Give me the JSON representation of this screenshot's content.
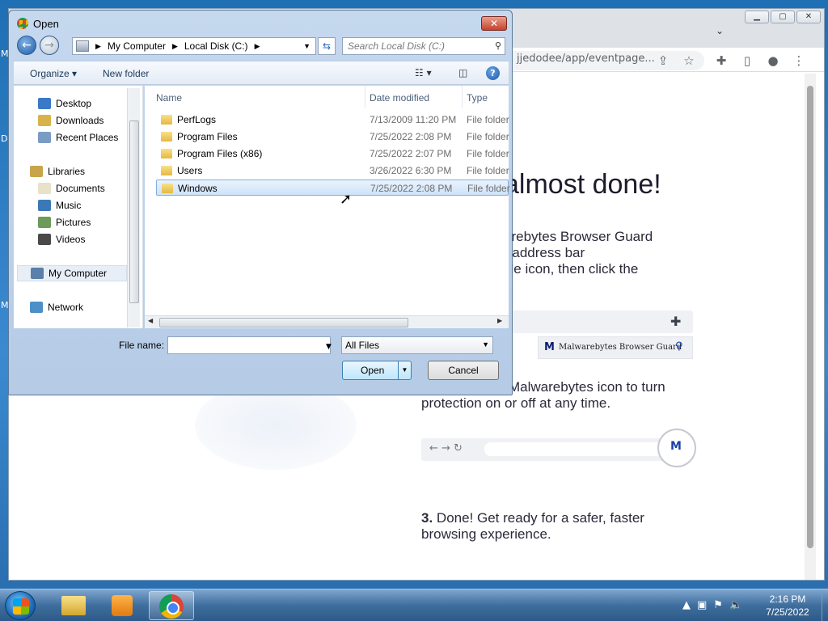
{
  "desktop": {
    "edge_letters": [
      "M",
      "D",
      "M"
    ]
  },
  "chrome": {
    "omnibox_text": "jjedodee/app/eventpage...",
    "page": {
      "headline": "almost done!",
      "step1_lines": [
        "arebytes Browser Guard",
        "r address bar",
        "zle icon, then click the"
      ],
      "illus1_label": "Malwarebytes Browser Guard",
      "step2_lines": [
        "Malwarebytes icon to turn",
        "protection on or off at any time."
      ],
      "step3_num": "3.",
      "step3_text": "Done! Get ready for a safer, faster browsing experience."
    }
  },
  "dialog": {
    "title": "Open",
    "breadcrumb": [
      "My Computer",
      "Local Disk (C:)"
    ],
    "search_placeholder": "Search Local Disk (C:)",
    "toolbar": {
      "organize": "Organize",
      "new_folder": "New folder"
    },
    "nav": {
      "favorites": [
        "Desktop",
        "Downloads",
        "Recent Places"
      ],
      "libraries_header": "Libraries",
      "libraries": [
        "Documents",
        "Music",
        "Pictures",
        "Videos"
      ],
      "computer": "My Computer",
      "network": "Network"
    },
    "columns": {
      "name": "Name",
      "date": "Date modified",
      "type": "Type"
    },
    "files": [
      {
        "name": "PerfLogs",
        "date": "7/13/2009 11:20 PM",
        "type": "File folder"
      },
      {
        "name": "Program Files",
        "date": "7/25/2022 2:08 PM",
        "type": "File folder"
      },
      {
        "name": "Program Files (x86)",
        "date": "7/25/2022 2:07 PM",
        "type": "File folder"
      },
      {
        "name": "Users",
        "date": "3/26/2022 6:30 PM",
        "type": "File folder"
      },
      {
        "name": "Windows",
        "date": "7/25/2022 2:08 PM",
        "type": "File folder"
      }
    ],
    "selected_file": "Windows",
    "file_name_label": "File name:",
    "file_name_value": "",
    "filter": "All Files",
    "open_label": "Open",
    "cancel_label": "Cancel"
  },
  "taskbar": {
    "time": "2:16 PM",
    "date": "7/25/2022"
  }
}
